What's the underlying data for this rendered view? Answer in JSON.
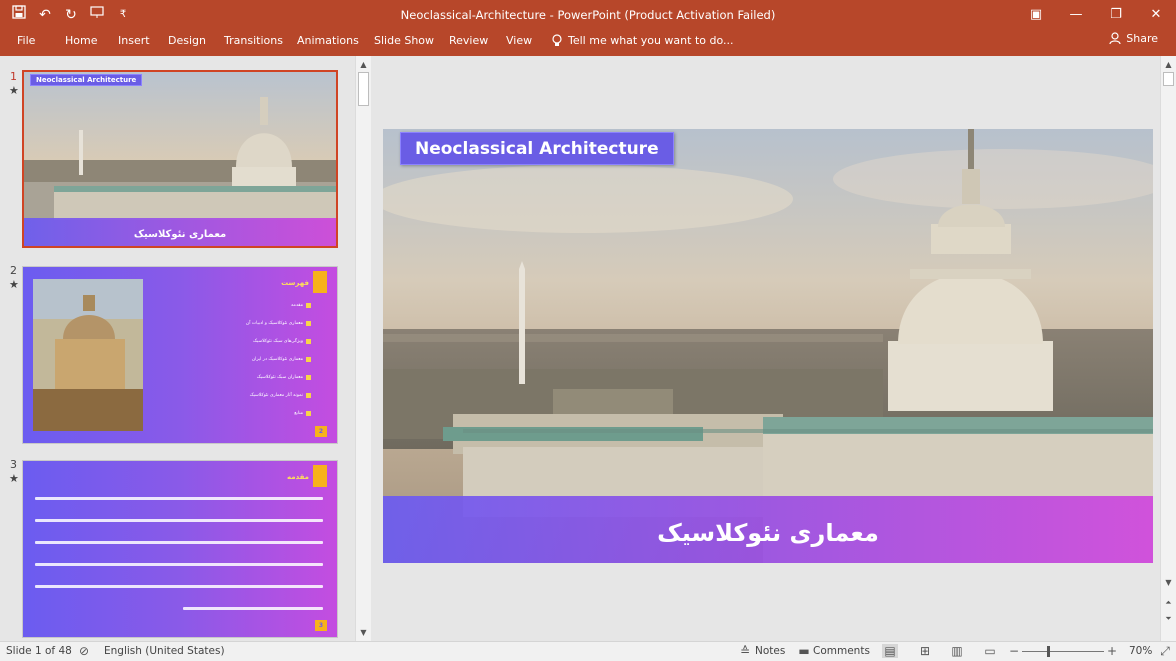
{
  "window": {
    "title": "Neoclassical-Architecture - PowerPoint (Product Activation Failed)",
    "controls": [
      "restore-ribbon",
      "minimize",
      "maximize",
      "close"
    ]
  },
  "qat": {
    "icons": [
      "save-icon",
      "undo-icon",
      "redo-icon",
      "present-icon",
      "customize-icon"
    ]
  },
  "ribbon": {
    "tabs": [
      "File",
      "Home",
      "Insert",
      "Design",
      "Transitions",
      "Animations",
      "Slide Show",
      "Review",
      "View"
    ],
    "tell_me": "Tell me what you want to do...",
    "share": "Share"
  },
  "thumbnails": {
    "items": [
      {
        "number": "1",
        "star": "★",
        "title": "Neoclassical Architecture",
        "subtitle": "معماری نئوکلاسیک",
        "selected": true
      },
      {
        "number": "2",
        "star": "★",
        "heading": "فهرست",
        "toc": [
          "مقدمه",
          "معماری نئوکلاسیک و ادبیات آن",
          "ویژگی‌های سبک نئوکلاسیک",
          "معماری نئوکلاسیک در ایران",
          "معماران سبک نئوکلاسیک",
          "نمونه آثار معماری نئوکلاسیک",
          "منابع"
        ],
        "page": "2"
      },
      {
        "number": "3",
        "star": "★",
        "heading": "مقدمه",
        "page": "3"
      }
    ]
  },
  "slide": {
    "title": "Neoclassical Architecture",
    "subtitle": "معماری نئوکلاسیک"
  },
  "status": {
    "slide_info": "Slide 1 of 48",
    "language": "English (United States)",
    "notes": "Notes",
    "comments": "Comments",
    "zoom": "70%"
  },
  "colors": {
    "accent": "#b7472a",
    "title_box": "#6a5de5",
    "band_start": "#6b5cf0",
    "band_end": "#d049dd",
    "yellow": "#f7b21b"
  }
}
